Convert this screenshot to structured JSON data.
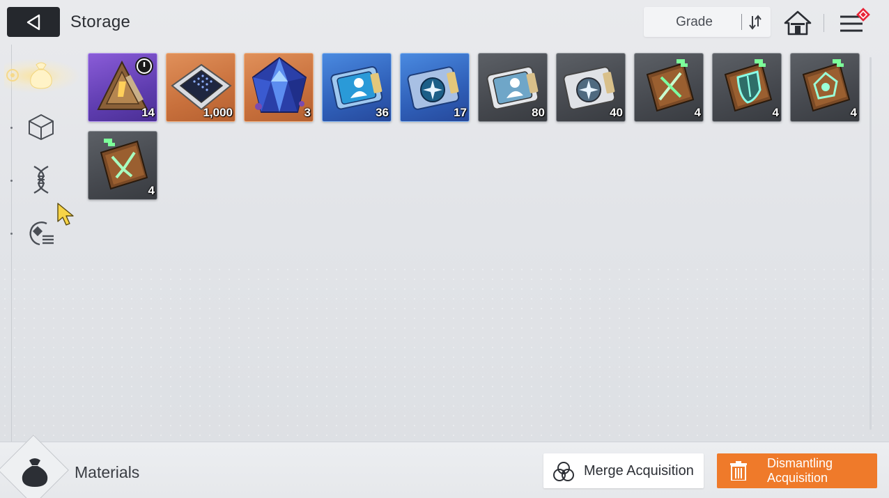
{
  "header": {
    "title": "Storage",
    "sort_label": "Grade",
    "icons": {
      "back": "back-arrow-icon",
      "sort": "sort-order-icon",
      "home": "home-icon",
      "menu": "menu-icon",
      "notification": "red-diamond-badge-icon"
    }
  },
  "sidebar": {
    "tabs": [
      {
        "name": "materials",
        "icon": "pouch-icon",
        "active": true
      },
      {
        "name": "boxes",
        "icon": "cube-icon",
        "active": false
      },
      {
        "name": "genes",
        "icon": "dna-icon",
        "active": false
      },
      {
        "name": "skill-chips",
        "icon": "chip-list-icon",
        "active": false
      }
    ]
  },
  "items": [
    {
      "icon": "triangle-token-icon",
      "grade": "purple",
      "count": "14",
      "timed": true
    },
    {
      "icon": "circuit-chip-icon",
      "grade": "orange",
      "count": "1,000",
      "timed": false
    },
    {
      "icon": "blue-crystal-icon",
      "grade": "orange",
      "count": "3",
      "timed": false
    },
    {
      "icon": "character-ticket-icon",
      "grade": "blue",
      "count": "36",
      "timed": false
    },
    {
      "icon": "gear-ticket-icon",
      "grade": "blue",
      "count": "17",
      "timed": false
    },
    {
      "icon": "character-ticket-icon",
      "grade": "gray",
      "count": "80",
      "timed": false
    },
    {
      "icon": "gear-ticket-icon",
      "grade": "gray",
      "count": "40",
      "timed": false
    },
    {
      "icon": "sword-book-icon",
      "grade": "gray",
      "count": "4",
      "timed": false
    },
    {
      "icon": "shield-book-icon",
      "grade": "gray",
      "count": "4",
      "timed": false
    },
    {
      "icon": "eye-book-icon",
      "grade": "gray",
      "count": "4",
      "timed": false
    },
    {
      "icon": "wing-book-icon",
      "grade": "gray",
      "count": "4",
      "timed": false
    }
  ],
  "footer": {
    "category_label": "Materials",
    "merge_label": "Merge Acquisition",
    "dismantle_label": "Dismantling Acquisition"
  },
  "colors": {
    "accent": "#ef7a2a",
    "header_dark": "#25282d",
    "purple": "#6b47c0",
    "orange": "#cc733f",
    "blue": "#3566c0",
    "gray": "#474a50"
  }
}
